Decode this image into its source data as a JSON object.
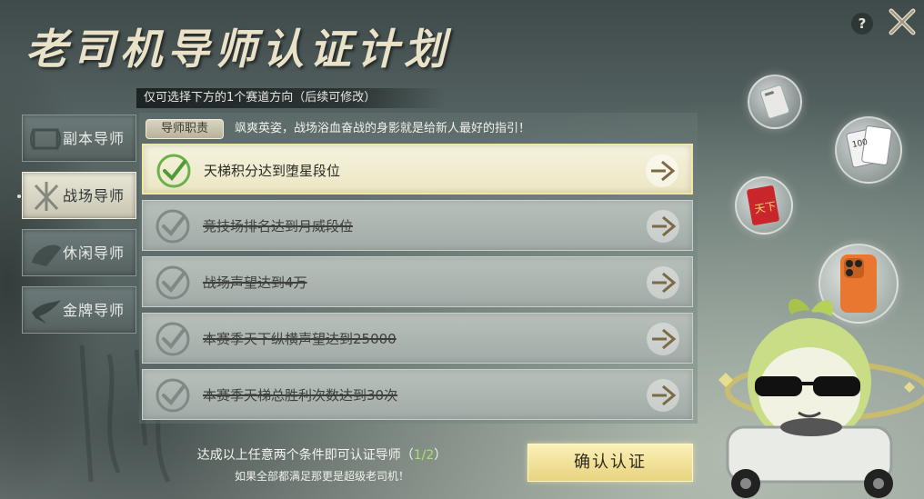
{
  "header": {
    "title": "老司机导师认证计划",
    "subtitle": "仅可选择下方的1个赛道方向（后续可修改）"
  },
  "top_buttons": {
    "help_label": "?"
  },
  "sidebar": {
    "items": [
      {
        "label": "副本导师",
        "icon": "scroll-icon",
        "active": false
      },
      {
        "label": "战场导师",
        "icon": "crossed-swords-icon",
        "active": true
      },
      {
        "label": "休闲导师",
        "icon": "fan-icon",
        "active": false
      },
      {
        "label": "金牌导师",
        "icon": "crane-icon",
        "active": false
      }
    ]
  },
  "duty": {
    "tag": "导师职责",
    "text": "飒爽英姿，战场浴血奋战的身影就是给新人最好的指引！"
  },
  "conditions": [
    {
      "text": "天梯积分达到堕星段位",
      "state": "active"
    },
    {
      "text": "竞技场排名达到月威段位",
      "state": "done"
    },
    {
      "text": "战场声望达到4万",
      "state": "done"
    },
    {
      "text": "本赛季天下纵横声望达到25000",
      "state": "done"
    },
    {
      "text": "本赛季天梯总胜利次数达到30次",
      "state": "done"
    }
  ],
  "footer": {
    "note_prefix": "达成以上任意两个条件即可认证导师（",
    "progress": "1/2",
    "note_suffix": "）",
    "note2": "如果全部都满足那更是超级老司机！",
    "confirm_label": "确认认证"
  },
  "rewards": {
    "items": [
      {
        "icon": "card-icon"
      },
      {
        "icon": "card-pack-icon",
        "card_text": "100"
      },
      {
        "icon": "red-envelope-icon",
        "text": "天下"
      },
      {
        "icon": "phone-icon"
      }
    ]
  },
  "colors": {
    "active_check": "#6bb04a",
    "done_check": "#7f8a86",
    "confirm_button": "#f1e29c",
    "progress_text": "#a9e06b"
  }
}
